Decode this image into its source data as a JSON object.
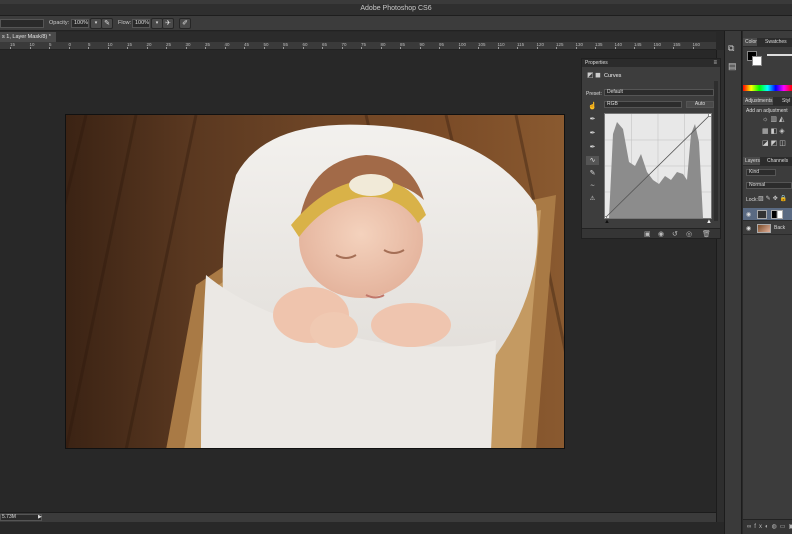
{
  "app": {
    "title": "Adobe Photoshop CS6"
  },
  "options_bar": {
    "opacity_label": "Opacity:",
    "opacity_value": "100%",
    "flow_label": "Flow:",
    "flow_value": "100%"
  },
  "document": {
    "tab_label": "s 1, Layer Mask/8) *",
    "zoom_value": "5.73M"
  },
  "ruler": {
    "ticks": [
      "15",
      "10",
      "5",
      "0",
      "5",
      "10",
      "15",
      "20",
      "25",
      "30",
      "35",
      "40",
      "45",
      "50",
      "55",
      "60",
      "65",
      "70",
      "75",
      "80",
      "85",
      "90",
      "95",
      "100",
      "105",
      "110",
      "115",
      "120",
      "125",
      "130",
      "135",
      "140",
      "145",
      "150",
      "155",
      "160"
    ]
  },
  "properties": {
    "header_label": "Properties",
    "panel_title": "Curves",
    "preset_label": "Preset:",
    "preset_value": "Default",
    "channel_value": "RGB",
    "auto_button": "Auto"
  },
  "right_panels": {
    "color_tab": "Color",
    "swatches_tab": "Swatches",
    "adjustments_tab": "Adjustments",
    "styles_tab": "Styl",
    "add_adjustment_text": "Add an adjustment",
    "layers_tab": "Layers",
    "channels_tab": "Channels",
    "kind_filter": "Kind",
    "blend_mode": "Normal",
    "lock_label": "Lock:",
    "layer_bg_name": "Back"
  },
  "colors": {
    "accent_foreground": "#000000",
    "accent_background": "#ffffff"
  }
}
